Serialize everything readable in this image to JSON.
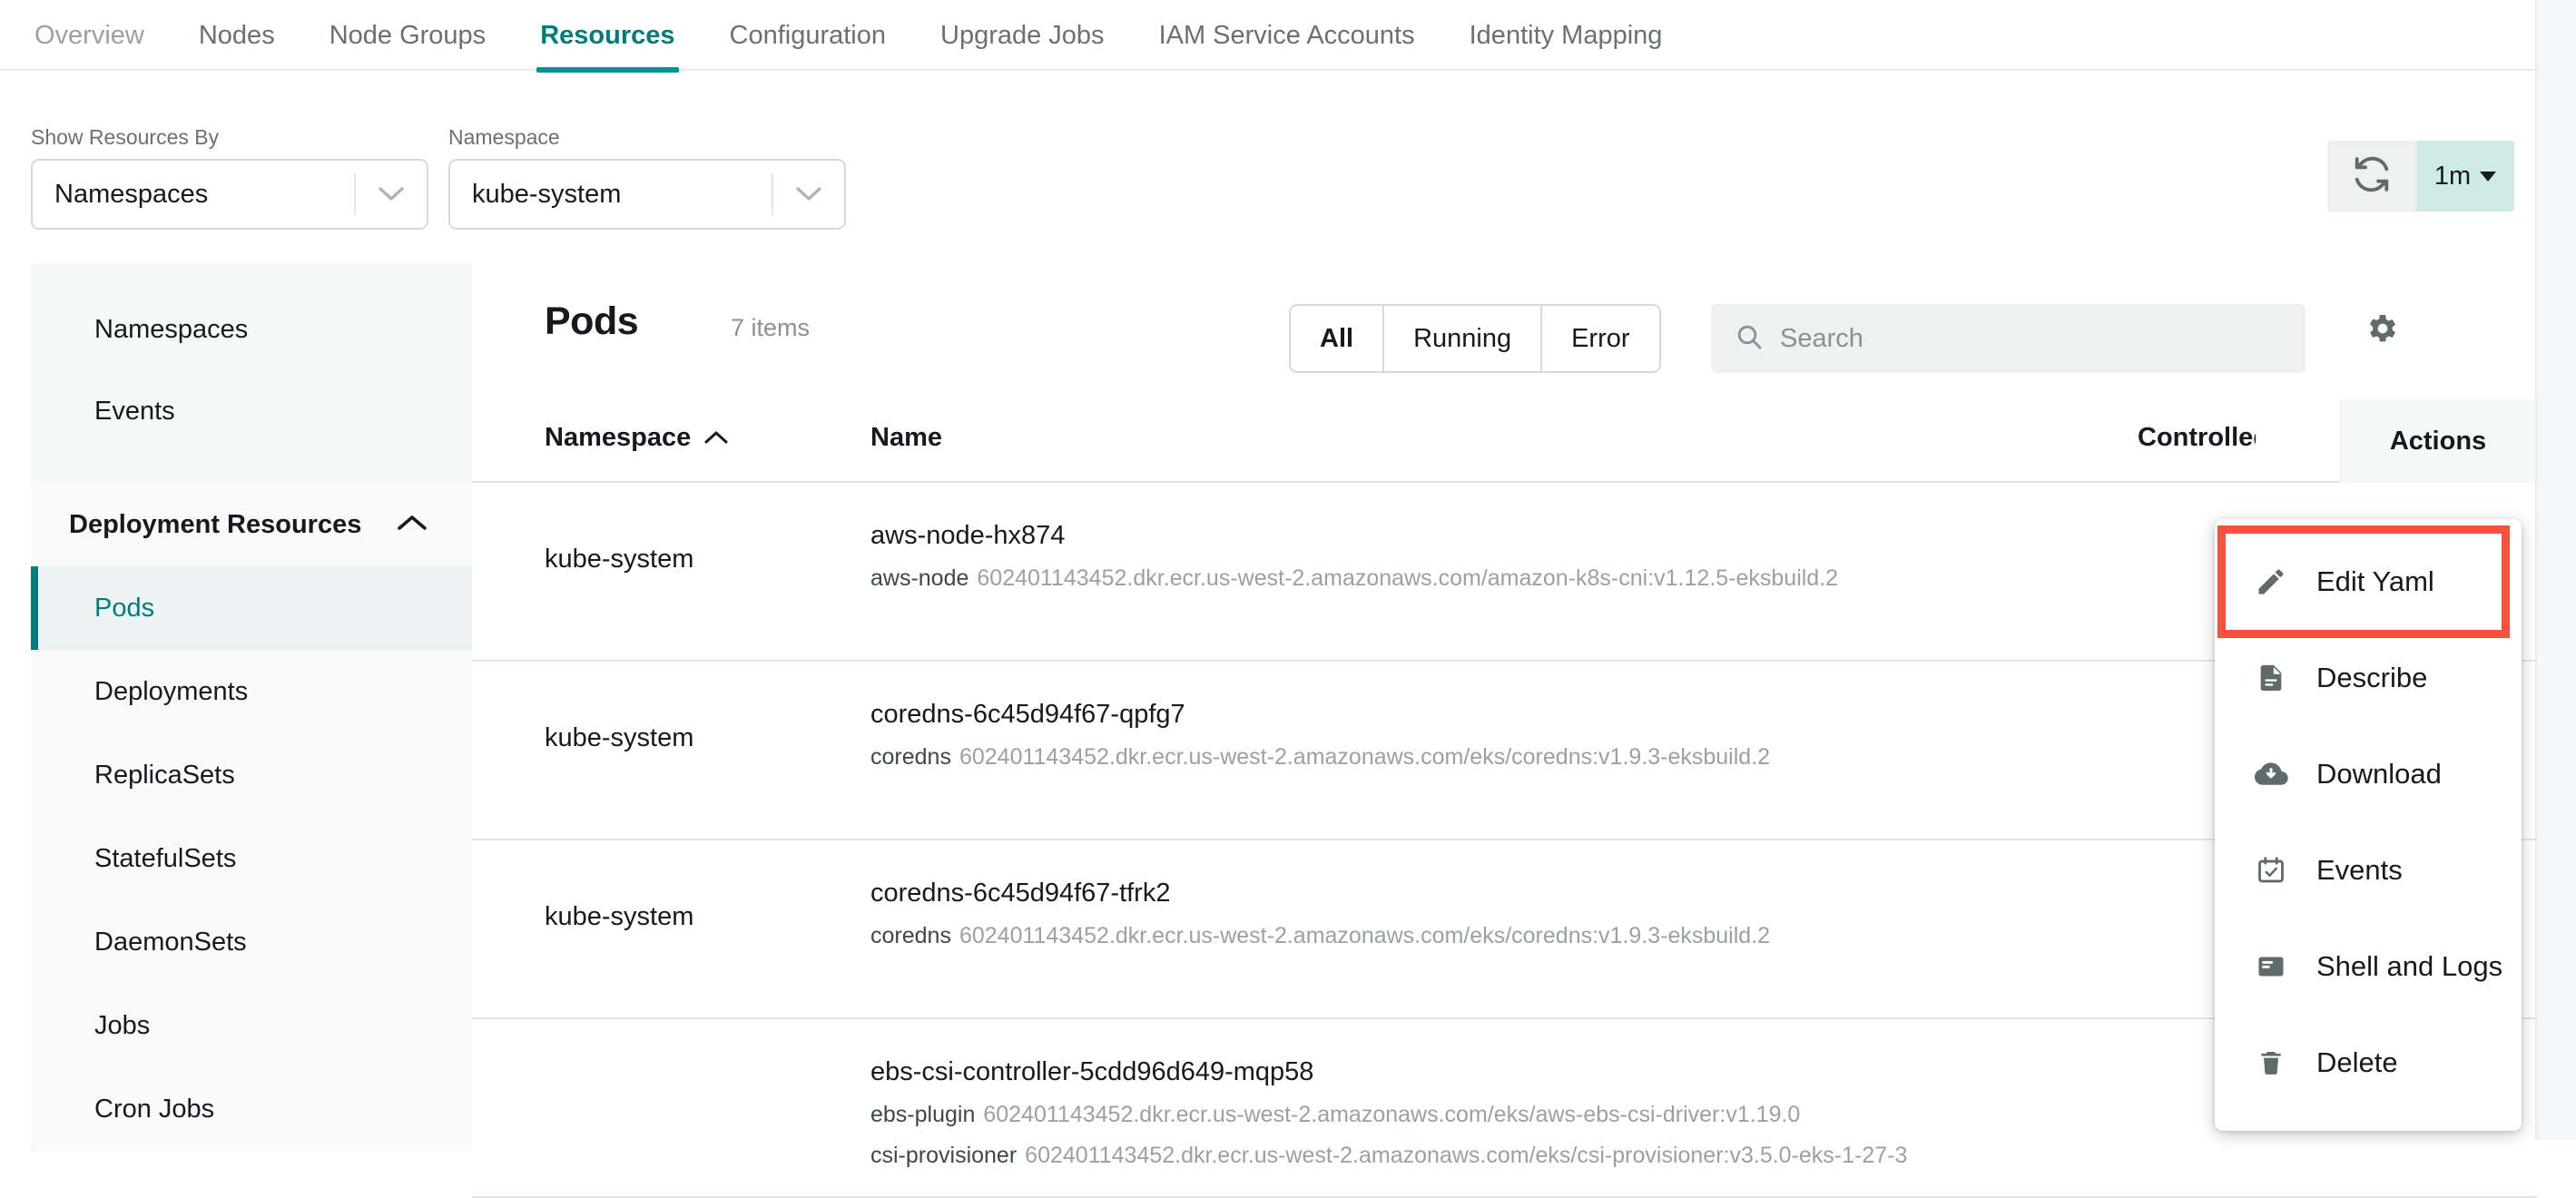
{
  "tabs": [
    {
      "label": "Overview",
      "state": "inactive-first"
    },
    {
      "label": "Nodes",
      "state": "inactive"
    },
    {
      "label": "Node Groups",
      "state": "inactive"
    },
    {
      "label": "Resources",
      "state": "active"
    },
    {
      "label": "Configuration",
      "state": "inactive"
    },
    {
      "label": "Upgrade Jobs",
      "state": "inactive"
    },
    {
      "label": "IAM Service Accounts",
      "state": "inactive"
    },
    {
      "label": "Identity Mapping",
      "state": "inactive"
    }
  ],
  "filters": {
    "show_by": {
      "label": "Show Resources By",
      "value": "Namespaces"
    },
    "namespace": {
      "label": "Namespace",
      "value": "kube-system"
    }
  },
  "refresh": {
    "icon": "refresh-icon",
    "interval": "1m"
  },
  "sidebar": {
    "top_items": [
      {
        "label": "Namespaces"
      },
      {
        "label": "Events"
      }
    ],
    "group": {
      "label": "Deployment Resources",
      "collapsed": false,
      "items": [
        {
          "label": "Pods",
          "active": true
        },
        {
          "label": "Deployments",
          "active": false
        },
        {
          "label": "ReplicaSets",
          "active": false
        },
        {
          "label": "StatefulSets",
          "active": false
        },
        {
          "label": "DaemonSets",
          "active": false
        },
        {
          "label": "Jobs",
          "active": false
        },
        {
          "label": "Cron Jobs",
          "active": false
        }
      ]
    }
  },
  "panel": {
    "title": "Pods",
    "count": "7 items",
    "segments": [
      {
        "label": "All",
        "selected": true
      },
      {
        "label": "Running",
        "selected": false
      },
      {
        "label": "Error",
        "selected": false
      }
    ],
    "search_placeholder": "Search",
    "settings_icon": "gear-icon"
  },
  "table": {
    "columns": {
      "namespace": "Namespace",
      "name": "Name",
      "controlled": "Controlled",
      "actions": "Actions"
    },
    "sort": {
      "column": "Namespace",
      "direction": "asc"
    },
    "rows": [
      {
        "namespace": "kube-system",
        "name": "aws-node-hx874",
        "containers": [
          {
            "name": "aws-node",
            "image": "602401143452.dkr.ecr.us-west-2.amazonaws.com/amazon-k8s-cni:v1.12.5-eksbuild.2"
          }
        ]
      },
      {
        "namespace": "kube-system",
        "name": "coredns-6c45d94f67-qpfg7",
        "containers": [
          {
            "name": "coredns",
            "image": "602401143452.dkr.ecr.us-west-2.amazonaws.com/eks/coredns:v1.9.3-eksbuild.2"
          }
        ]
      },
      {
        "namespace": "kube-system",
        "name": "coredns-6c45d94f67-tfrk2",
        "containers": [
          {
            "name": "coredns",
            "image": "602401143452.dkr.ecr.us-west-2.amazonaws.com/eks/coredns:v1.9.3-eksbuild.2"
          }
        ]
      },
      {
        "namespace": "",
        "name": "ebs-csi-controller-5cdd96d649-mqp58",
        "containers": [
          {
            "name": "ebs-plugin",
            "image": "602401143452.dkr.ecr.us-west-2.amazonaws.com/eks/aws-ebs-csi-driver:v1.19.0"
          },
          {
            "name": "csi-provisioner",
            "image": "602401143452.dkr.ecr.us-west-2.amazonaws.com/eks/csi-provisioner:v3.5.0-eks-1-27-3"
          }
        ]
      }
    ]
  },
  "actions_menu": {
    "items": [
      {
        "label": "Edit Yaml",
        "icon": "pencil-icon",
        "highlighted": true
      },
      {
        "label": "Describe",
        "icon": "document-icon",
        "highlighted": false
      },
      {
        "label": "Download",
        "icon": "cloud-download-icon",
        "highlighted": false
      },
      {
        "label": "Events",
        "icon": "calendar-check-icon",
        "highlighted": false
      },
      {
        "label": "Shell and Logs",
        "icon": "terminal-icon",
        "highlighted": false
      },
      {
        "label": "Delete",
        "icon": "trash-icon",
        "highlighted": false
      }
    ]
  },
  "colors": {
    "accent_teal": "#007c7c",
    "interval_bg": "#cfe9e7",
    "highlight_red": "#f8523c"
  }
}
